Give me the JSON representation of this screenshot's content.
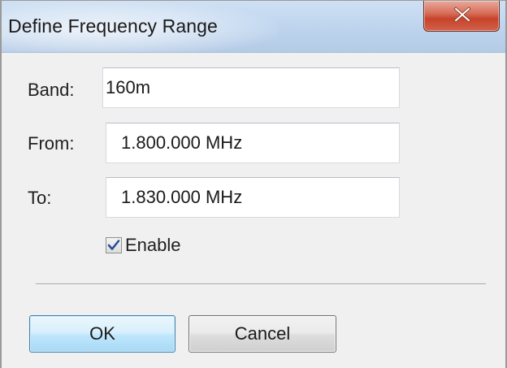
{
  "window": {
    "title": "Define Frequency Range",
    "close_icon": "close-icon"
  },
  "form": {
    "band_label": "Band:",
    "band_value": "160m",
    "from_label": "From:",
    "from_value": "1.800.000 MHz",
    "to_label": "To:",
    "to_value": "1.830.000 MHz",
    "enable_label": "Enable",
    "enable_checked": true
  },
  "buttons": {
    "ok_label": "OK",
    "cancel_label": "Cancel"
  },
  "colors": {
    "titlebar": "#c0d6ef",
    "close_button": "#c7432b",
    "default_button_border": "#3c7fb1",
    "client_background": "#f0f0f0"
  }
}
